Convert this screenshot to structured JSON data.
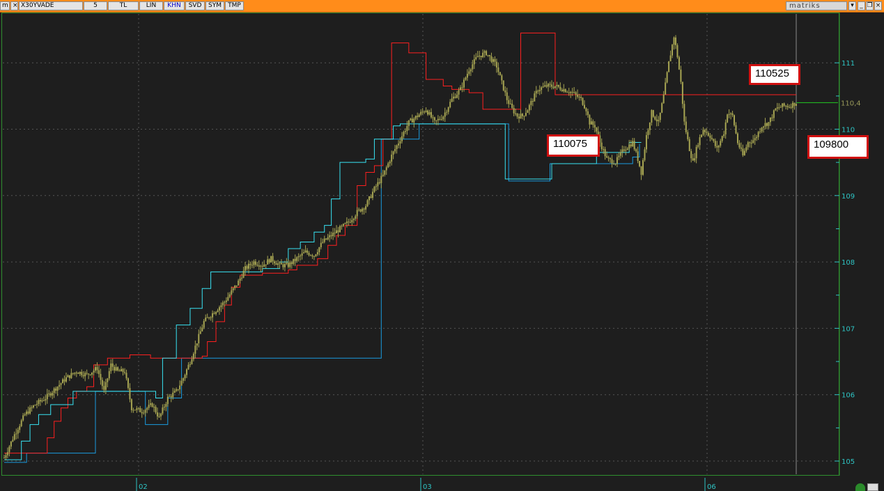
{
  "toolbar": {
    "symbol": "X30YVADE",
    "period": "5",
    "currency": "TL",
    "scale": "LIN",
    "mode_khn": "KHN",
    "mode_svd": "SVD",
    "mode_sym": "SYM",
    "mode_tmp": "TMP",
    "brand": "matriks",
    "colors": {
      "bar": "#ff8c1a",
      "active_button_text": "#0000cc"
    }
  },
  "chart_data": {
    "type": "candlestick",
    "y_axis": {
      "range": [
        104.9,
        111.6
      ],
      "ticks": [
        "105",
        "106",
        "107",
        "108",
        "109",
        "110",
        "111"
      ],
      "last_value_label": "110,4",
      "last_value": 110.4
    },
    "x_axis": {
      "tick_labels": [
        "02",
        "03",
        "06"
      ]
    },
    "colors": {
      "background": "#1e1e1e",
      "candles": "#a7a552",
      "red_line": "#ff2020",
      "light_blue_line": "#38e4f4",
      "dark_blue_line": "#1a9ce0",
      "axis_text": "#2ec4c4",
      "grid": "#555555",
      "last_value_line": "#22cc22"
    },
    "candle_path": {
      "description_free": true,
      "close_points": [
        [
          0,
          105.05
        ],
        [
          6,
          105.4
        ],
        [
          12,
          105.7
        ],
        [
          18,
          105.85
        ],
        [
          24,
          105.95
        ],
        [
          30,
          106.1
        ],
        [
          36,
          106.25
        ],
        [
          42,
          106.35
        ],
        [
          48,
          106.3
        ],
        [
          54,
          106.4
        ],
        [
          58,
          106.05
        ],
        [
          62,
          106.45
        ],
        [
          66,
          106.35
        ],
        [
          70,
          106.35
        ],
        [
          74,
          105.8
        ],
        [
          80,
          105.75
        ],
        [
          86,
          105.85
        ],
        [
          90,
          105.65
        ],
        [
          95,
          105.95
        ],
        [
          100,
          106.05
        ],
        [
          104,
          106.25
        ],
        [
          108,
          106.5
        ],
        [
          112,
          106.8
        ],
        [
          116,
          107.1
        ],
        [
          120,
          107.2
        ],
        [
          124,
          107.3
        ],
        [
          128,
          107.4
        ],
        [
          132,
          107.55
        ],
        [
          136,
          107.7
        ],
        [
          140,
          107.9
        ],
        [
          145,
          108.0
        ],
        [
          150,
          107.95
        ],
        [
          155,
          108.05
        ],
        [
          160,
          107.95
        ],
        [
          165,
          107.95
        ],
        [
          170,
          108.05
        ],
        [
          175,
          108.15
        ],
        [
          180,
          108.1
        ],
        [
          185,
          108.3
        ],
        [
          190,
          108.4
        ],
        [
          195,
          108.5
        ],
        [
          200,
          108.6
        ],
        [
          205,
          108.75
        ],
        [
          210,
          108.85
        ],
        [
          215,
          109.1
        ],
        [
          220,
          109.3
        ],
        [
          225,
          109.6
        ],
        [
          230,
          109.85
        ],
        [
          235,
          110.1
        ],
        [
          240,
          110.2
        ],
        [
          245,
          110.3
        ],
        [
          250,
          110.1
        ],
        [
          255,
          110.2
        ],
        [
          260,
          110.45
        ],
        [
          265,
          110.6
        ],
        [
          270,
          110.9
        ],
        [
          275,
          111.1
        ],
        [
          280,
          111.15
        ],
        [
          283,
          111.05
        ],
        [
          286,
          110.95
        ],
        [
          289,
          110.7
        ],
        [
          292,
          110.45
        ],
        [
          295,
          110.3
        ],
        [
          298,
          110.2
        ],
        [
          301,
          110.2
        ],
        [
          304,
          110.3
        ],
        [
          307,
          110.45
        ],
        [
          310,
          110.6
        ],
        [
          315,
          110.65
        ],
        [
          320,
          110.65
        ],
        [
          325,
          110.6
        ],
        [
          330,
          110.55
        ],
        [
          335,
          110.45
        ],
        [
          338,
          110.3
        ],
        [
          340,
          110.1
        ],
        [
          343,
          110.05
        ],
        [
          346,
          109.8
        ],
        [
          350,
          109.55
        ],
        [
          355,
          109.5
        ],
        [
          360,
          109.7
        ],
        [
          365,
          109.8
        ],
        [
          368,
          109.55
        ],
        [
          370,
          109.35
        ],
        [
          373,
          109.9
        ],
        [
          376,
          110.25
        ],
        [
          380,
          110.1
        ],
        [
          383,
          110.5
        ],
        [
          386,
          111.0
        ],
        [
          389,
          111.4
        ],
        [
          391,
          111.1
        ],
        [
          393,
          110.7
        ],
        [
          395,
          110.1
        ],
        [
          398,
          109.7
        ],
        [
          400,
          109.5
        ],
        [
          403,
          109.8
        ],
        [
          406,
          110.0
        ],
        [
          410,
          109.9
        ],
        [
          414,
          109.7
        ],
        [
          418,
          109.95
        ],
        [
          420,
          110.25
        ],
        [
          423,
          110.2
        ],
        [
          426,
          109.8
        ],
        [
          429,
          109.6
        ],
        [
          432,
          109.8
        ],
        [
          436,
          109.85
        ],
        [
          440,
          110.05
        ],
        [
          444,
          110.1
        ],
        [
          448,
          110.3
        ],
        [
          452,
          110.35
        ],
        [
          456,
          110.35
        ],
        [
          460,
          110.4
        ]
      ]
    },
    "overlay_series": {
      "red_line": [
        [
          0,
          105.12
        ],
        [
          22,
          105.12
        ],
        [
          25,
          105.35
        ],
        [
          29,
          105.6
        ],
        [
          33,
          105.8
        ],
        [
          37,
          105.95
        ],
        [
          42,
          106.05
        ],
        [
          48,
          106.12
        ],
        [
          52,
          106.45
        ],
        [
          60,
          106.55
        ],
        [
          73,
          106.6
        ],
        [
          85,
          106.55
        ],
        [
          115,
          106.58
        ],
        [
          118,
          106.8
        ],
        [
          123,
          107.1
        ],
        [
          128,
          107.35
        ],
        [
          132,
          107.62
        ],
        [
          137,
          107.8
        ],
        [
          150,
          107.83
        ],
        [
          165,
          107.88
        ],
        [
          170,
          107.95
        ],
        [
          182,
          108.05
        ],
        [
          188,
          108.25
        ],
        [
          193,
          108.4
        ],
        [
          198,
          108.55
        ],
        [
          205,
          109.15
        ],
        [
          210,
          109.35
        ],
        [
          215,
          109.45
        ],
        [
          220,
          109.85
        ],
        [
          225,
          111.3
        ],
        [
          235,
          111.15
        ],
        [
          245,
          110.75
        ],
        [
          255,
          110.65
        ],
        [
          260,
          110.6
        ],
        [
          270,
          110.55
        ],
        [
          278,
          110.3
        ],
        [
          292,
          110.3
        ],
        [
          300,
          111.45
        ],
        [
          318,
          111.45
        ],
        [
          320,
          110.52
        ],
        [
          335,
          110.52
        ],
        [
          460,
          110.52
        ]
      ],
      "light_blue_line": [
        [
          0,
          105.02
        ],
        [
          10,
          105.3
        ],
        [
          15,
          105.55
        ],
        [
          20,
          105.7
        ],
        [
          27,
          105.85
        ],
        [
          40,
          106.05
        ],
        [
          59,
          106.05
        ],
        [
          80,
          106.05
        ],
        [
          88,
          105.95
        ],
        [
          92,
          106.55
        ],
        [
          100,
          107.05
        ],
        [
          108,
          107.3
        ],
        [
          115,
          107.6
        ],
        [
          120,
          107.85
        ],
        [
          140,
          107.85
        ],
        [
          150,
          107.9
        ],
        [
          160,
          108.0
        ],
        [
          165,
          108.2
        ],
        [
          172,
          108.3
        ],
        [
          180,
          108.45
        ],
        [
          186,
          108.55
        ],
        [
          190,
          108.95
        ],
        [
          195,
          109.5
        ],
        [
          210,
          109.55
        ],
        [
          215,
          109.85
        ],
        [
          225,
          109.85
        ],
        [
          226,
          110.05
        ],
        [
          230,
          110.08
        ],
        [
          250,
          110.08
        ],
        [
          290,
          110.08
        ],
        [
          291,
          109.25
        ],
        [
          316,
          109.25
        ],
        [
          318,
          109.48
        ],
        [
          340,
          109.48
        ],
        [
          344,
          109.65
        ],
        [
          360,
          109.65
        ],
        [
          363,
          109.8
        ],
        [
          370,
          109.8
        ]
      ],
      "dark_blue_line": [
        [
          0,
          104.98
        ],
        [
          12,
          104.98
        ],
        [
          13,
          105.12
        ],
        [
          50,
          105.12
        ],
        [
          53,
          106.05
        ],
        [
          79,
          106.05
        ],
        [
          82,
          105.55
        ],
        [
          92,
          105.55
        ],
        [
          95,
          105.95
        ],
        [
          101,
          105.95
        ],
        [
          103,
          106.55
        ],
        [
          217,
          106.55
        ],
        [
          219,
          109.85
        ],
        [
          238,
          109.85
        ],
        [
          241,
          110.08
        ],
        [
          292,
          110.08
        ],
        [
          293,
          109.22
        ],
        [
          315,
          109.22
        ],
        [
          317,
          109.48
        ],
        [
          362,
          109.48
        ],
        [
          365,
          109.58
        ],
        [
          369,
          109.78
        ]
      ]
    },
    "annotations": [
      {
        "label": "110525",
        "value": 110525
      },
      {
        "label": "110075",
        "value": 110075
      },
      {
        "label": "109800",
        "value": 109800
      }
    ],
    "grid": true
  }
}
